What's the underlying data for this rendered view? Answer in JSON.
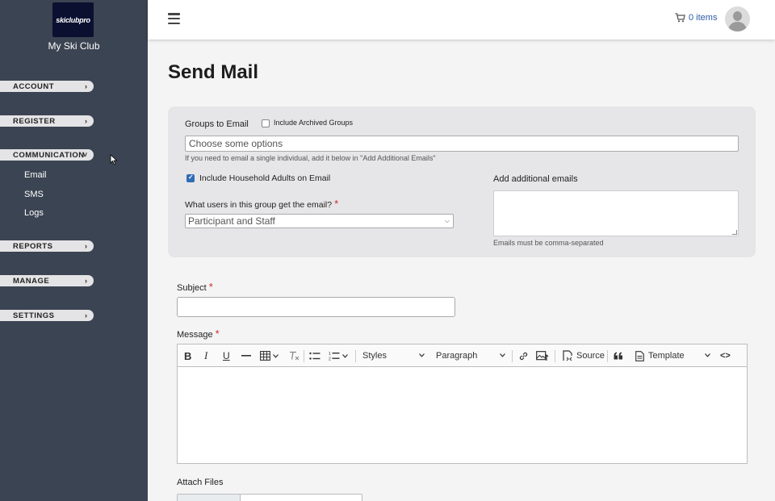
{
  "sidebar": {
    "logo_text": "skiclubpro",
    "club_name": "My Ski Club",
    "nav": [
      {
        "label": "ACCOUNT",
        "chevron": "›"
      },
      {
        "label": "REGISTER",
        "chevron": "›"
      },
      {
        "label": "COMMUNICATION",
        "chevron": "˅"
      },
      {
        "label": "REPORTS",
        "chevron": "›"
      },
      {
        "label": "MANAGE",
        "chevron": "›"
      },
      {
        "label": "SETTINGS",
        "chevron": "›"
      }
    ],
    "communication_sub": [
      "Email",
      "SMS",
      "Logs"
    ]
  },
  "header": {
    "cart_label": "0 items",
    "cart_icon": "cart-icon",
    "menu_icon": "hamburger-icon",
    "avatar_icon": "user-avatar-icon"
  },
  "page": {
    "title": "Send Mail"
  },
  "groups": {
    "label": "Groups to Email",
    "include_archived_label": "Include Archived Groups",
    "include_archived_checked": false,
    "placeholder": "Choose some options",
    "help": "If you need to email a single individual, add it below in \"Add Additional Emails\"",
    "household_label": "Include Household Adults on Email",
    "household_checked": true,
    "users_label": "What users in this group get the email?",
    "users_required": "*",
    "users_value": "Participant and Staff",
    "additional_label": "Add additional emails",
    "additional_help": "Emails must be comma-separated"
  },
  "subject": {
    "label": "Subject",
    "required": "*",
    "value": ""
  },
  "message": {
    "label": "Message",
    "required": "*",
    "toolbar": {
      "bold": "B",
      "italic": "I",
      "underline": "U",
      "styles": "Styles",
      "paragraph": "Paragraph",
      "source": "Source",
      "template": "Template",
      "code": "<>"
    }
  },
  "attach": {
    "label": "Attach Files"
  },
  "colors": {
    "sidebar": "#3b4452",
    "accent": "#2f6db5",
    "required": "#d02a2a"
  }
}
